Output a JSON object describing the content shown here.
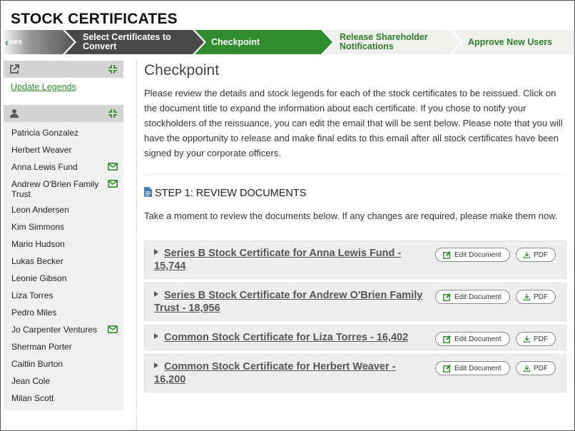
{
  "app": {
    "title": "STOCK CERTIFICATES"
  },
  "stepper": {
    "back_label": "ses",
    "steps": [
      {
        "label": "Select Certificates to Convert",
        "state": "done"
      },
      {
        "label": "Checkpoint",
        "state": "current"
      },
      {
        "label": "Release Shareholder Notifications",
        "state": "upcoming"
      },
      {
        "label": "Approve New Users",
        "state": "upcoming"
      }
    ]
  },
  "sidebar": {
    "legends_panel": {
      "icon": "external-link-icon",
      "link": "Update Legends"
    },
    "people_panel": {
      "icon": "user-icon",
      "people": [
        {
          "name": "Patricia Gonzalez",
          "emailed": false
        },
        {
          "name": "Herbert Weaver",
          "emailed": false
        },
        {
          "name": "Anna Lewis Fund",
          "emailed": true
        },
        {
          "name": "Andrew O'Brien Family Trust",
          "emailed": true
        },
        {
          "name": "Leon Andersen",
          "emailed": false
        },
        {
          "name": "Kim Simmons",
          "emailed": false
        },
        {
          "name": "Mario Hudson",
          "emailed": false
        },
        {
          "name": "Lukas Becker",
          "emailed": false
        },
        {
          "name": "Leonie Gibson",
          "emailed": false
        },
        {
          "name": "Liza Torres",
          "emailed": false
        },
        {
          "name": "Pedro Miles",
          "emailed": false
        },
        {
          "name": "Jo Carpenter Ventures",
          "emailed": true
        },
        {
          "name": "Sherman Porter",
          "emailed": false
        },
        {
          "name": "Caitlin Burton",
          "emailed": false
        },
        {
          "name": "Jean Cole",
          "emailed": false
        },
        {
          "name": "Milan Scott",
          "emailed": false
        }
      ]
    }
  },
  "main": {
    "title": "Checkpoint",
    "intro": "Please review the details and stock legends for each of the stock certificates to be reissued. Click on the document title to expand the information about each certificate. If you chose to notify your stockholders of the reissuance, you can edit the email that will be sent below. Please note that you will have the opportunity to release and make final edits to this email after all stock certificates have been signed by your corporate officers.",
    "step1": {
      "title": "STEP 1: REVIEW DOCUMENTS",
      "description": "Take a moment to review the documents below. If any changes are required, please make them now."
    },
    "edit_label": "Edit Document",
    "pdf_label": "PDF",
    "documents": [
      {
        "title": "Series B Stock Certificate for Anna Lewis Fund - 15,744"
      },
      {
        "title": "Series B Stock Certificate for Andrew O'Brien Family Trust - 18,956"
      },
      {
        "title": "Common Stock Certificate for Liza Torres - 16,402"
      },
      {
        "title": "Common Stock Certificate for Herbert Weaver - 16,200"
      }
    ]
  },
  "colors": {
    "accent_green": "#2e8b2e",
    "step_dark": "#4a4a4a",
    "step_light": "#f0f0ec",
    "panel_head": "#d4d4d4"
  }
}
